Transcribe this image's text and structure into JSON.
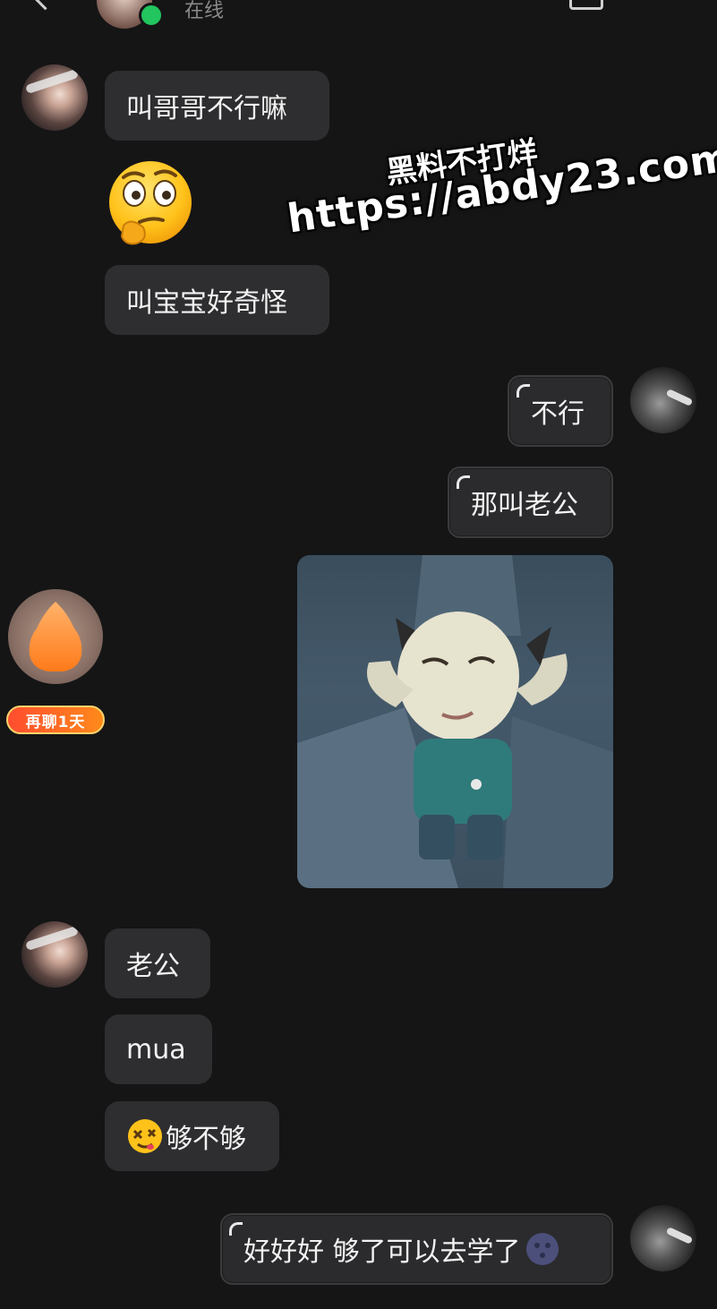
{
  "header": {
    "status": "在线"
  },
  "messages": {
    "m1": "叫哥哥不行嘛",
    "m2": "叫宝宝好奇怪",
    "m3": "不行",
    "m4": "那叫老公",
    "m5": "老公",
    "m6": "mua",
    "m7": "够不够",
    "m8": "好好好 够了可以去学了"
  },
  "badge": {
    "label": "再聊1天"
  },
  "watermark": {
    "line1": "黑料不打烊",
    "line2": "https://abdy23.com"
  },
  "colors": {
    "background": "#151516",
    "bubble": "#2e2e30",
    "online": "#22c55e",
    "badge": "#ff5a1f"
  }
}
